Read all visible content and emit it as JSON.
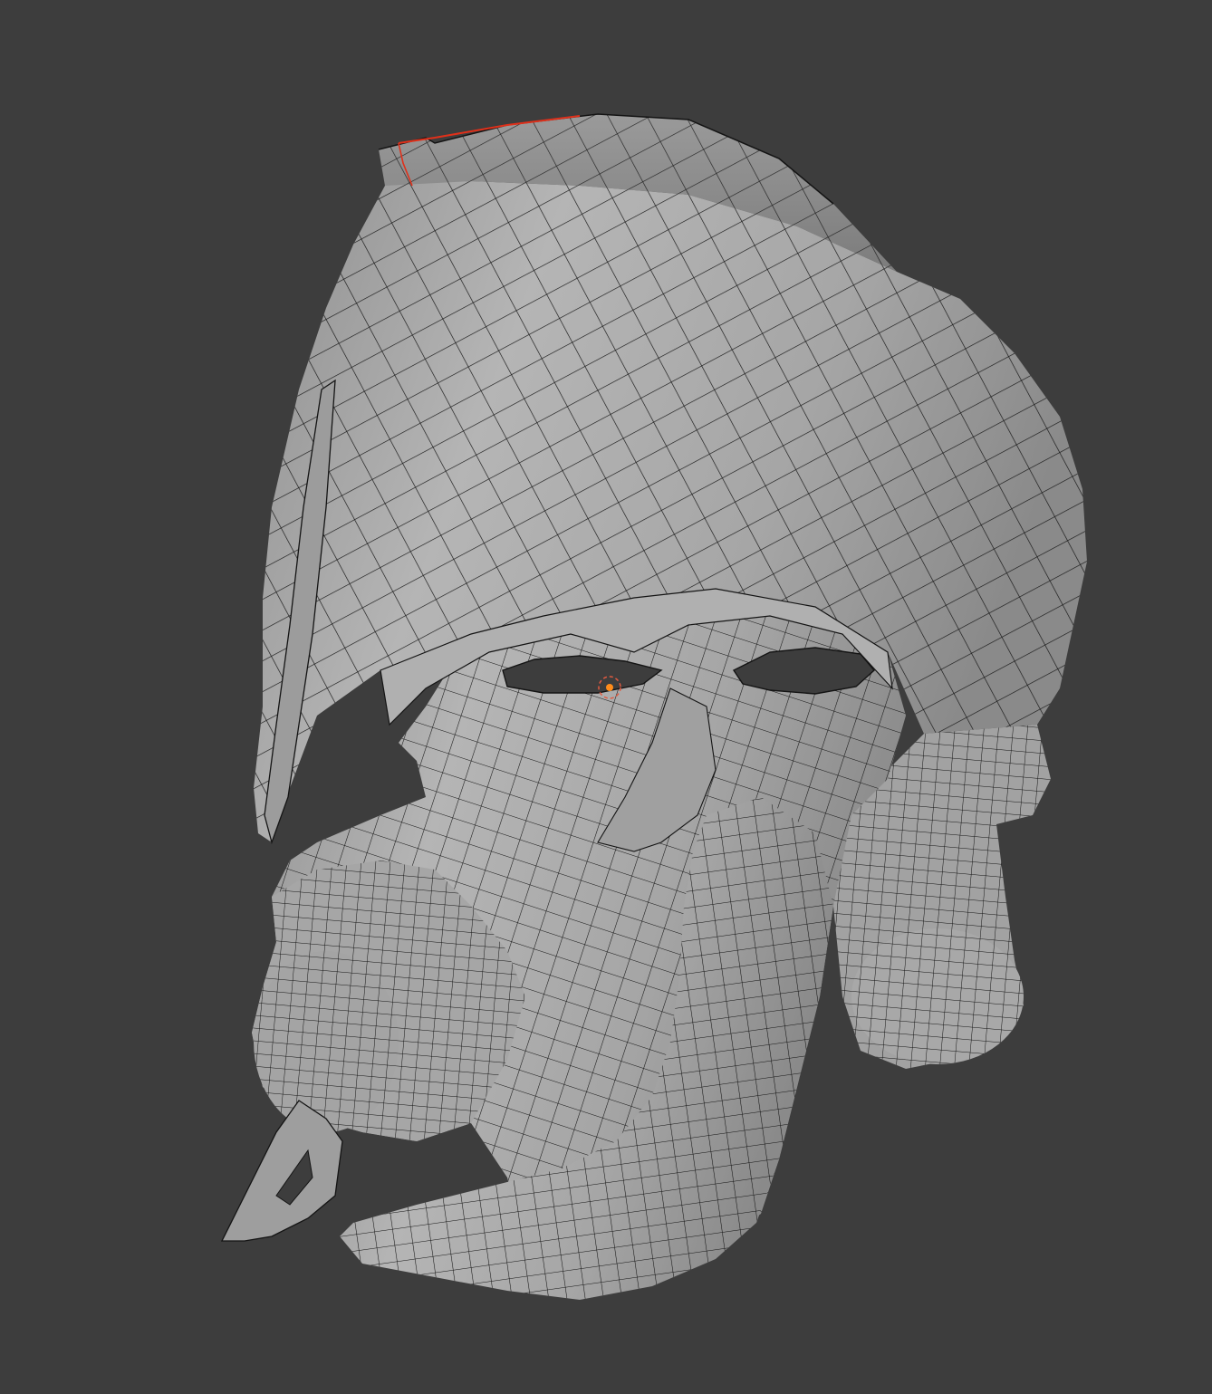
{
  "viewport": {
    "background_color": "#3d3d3d",
    "mode": "edit-mode-wireframe-on-solid",
    "object": {
      "kind": "mask-mesh",
      "surface_color": "#a9a9a9",
      "wire_color": "#111111",
      "selected_edge_color": "#e0301a"
    },
    "origin_marker": {
      "fill_color": "#ff8c1a",
      "ring_color": "#e05a40"
    }
  }
}
